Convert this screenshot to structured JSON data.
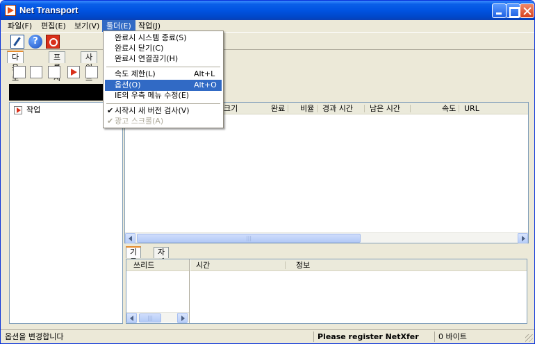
{
  "window": {
    "title": "Net Transport"
  },
  "menubar": [
    {
      "label": "파일(F)"
    },
    {
      "label": "편집(E)"
    },
    {
      "label": "보기(V)"
    },
    {
      "label": "툴더(E)"
    },
    {
      "label": "작업(J)"
    }
  ],
  "toolbar": {
    "help_glyph": "?"
  },
  "left_panel": {
    "tabs": [
      {
        "label": "다운로드"
      },
      {
        "label": "프록시"
      },
      {
        "label": "사이트"
      }
    ],
    "tree": [
      {
        "label": "작업"
      }
    ]
  },
  "list": {
    "columns": [
      {
        "label": "크기"
      },
      {
        "label": "완료"
      },
      {
        "label": "비율"
      },
      {
        "label": "경과 시간"
      },
      {
        "label": "남은 시간"
      },
      {
        "label": "속도"
      },
      {
        "label": "URL"
      }
    ],
    "scroll_thumb": "|||"
  },
  "log_panel": {
    "tabs": [
      {
        "label": "기록"
      },
      {
        "label": "자세히"
      }
    ],
    "thread_header": "쓰리드",
    "time_header": "시간",
    "info_header": "정보",
    "scroll_thumb": "|||"
  },
  "status": {
    "message": "옵션을 변경합니다",
    "register": "Please register NetXfer",
    "bytes": "0 바이트"
  },
  "dropdown": {
    "items": [
      {
        "label": "완료시 시스템 종료(S)",
        "accel": ""
      },
      {
        "label": "완료시 닫기(C)",
        "accel": ""
      },
      {
        "label": "완료시 연결끊기(H)",
        "accel": ""
      },
      {
        "label": "속도 제한(L)",
        "accel": "Alt+L"
      },
      {
        "label": "옵션(O)",
        "accel": "Alt+O"
      },
      {
        "label": "IE의 우측 메뉴 수정(E)",
        "accel": ""
      },
      {
        "label": "시작시 새 버전 검사(V)",
        "accel": "",
        "check": "✔"
      },
      {
        "label": "광고 스크롤(A)",
        "accel": "",
        "check": "✔"
      }
    ]
  },
  "colors": {
    "titlebar": "#0053e1",
    "menu_highlight": "#316ac5",
    "tab_accent": "#e68b2c"
  }
}
